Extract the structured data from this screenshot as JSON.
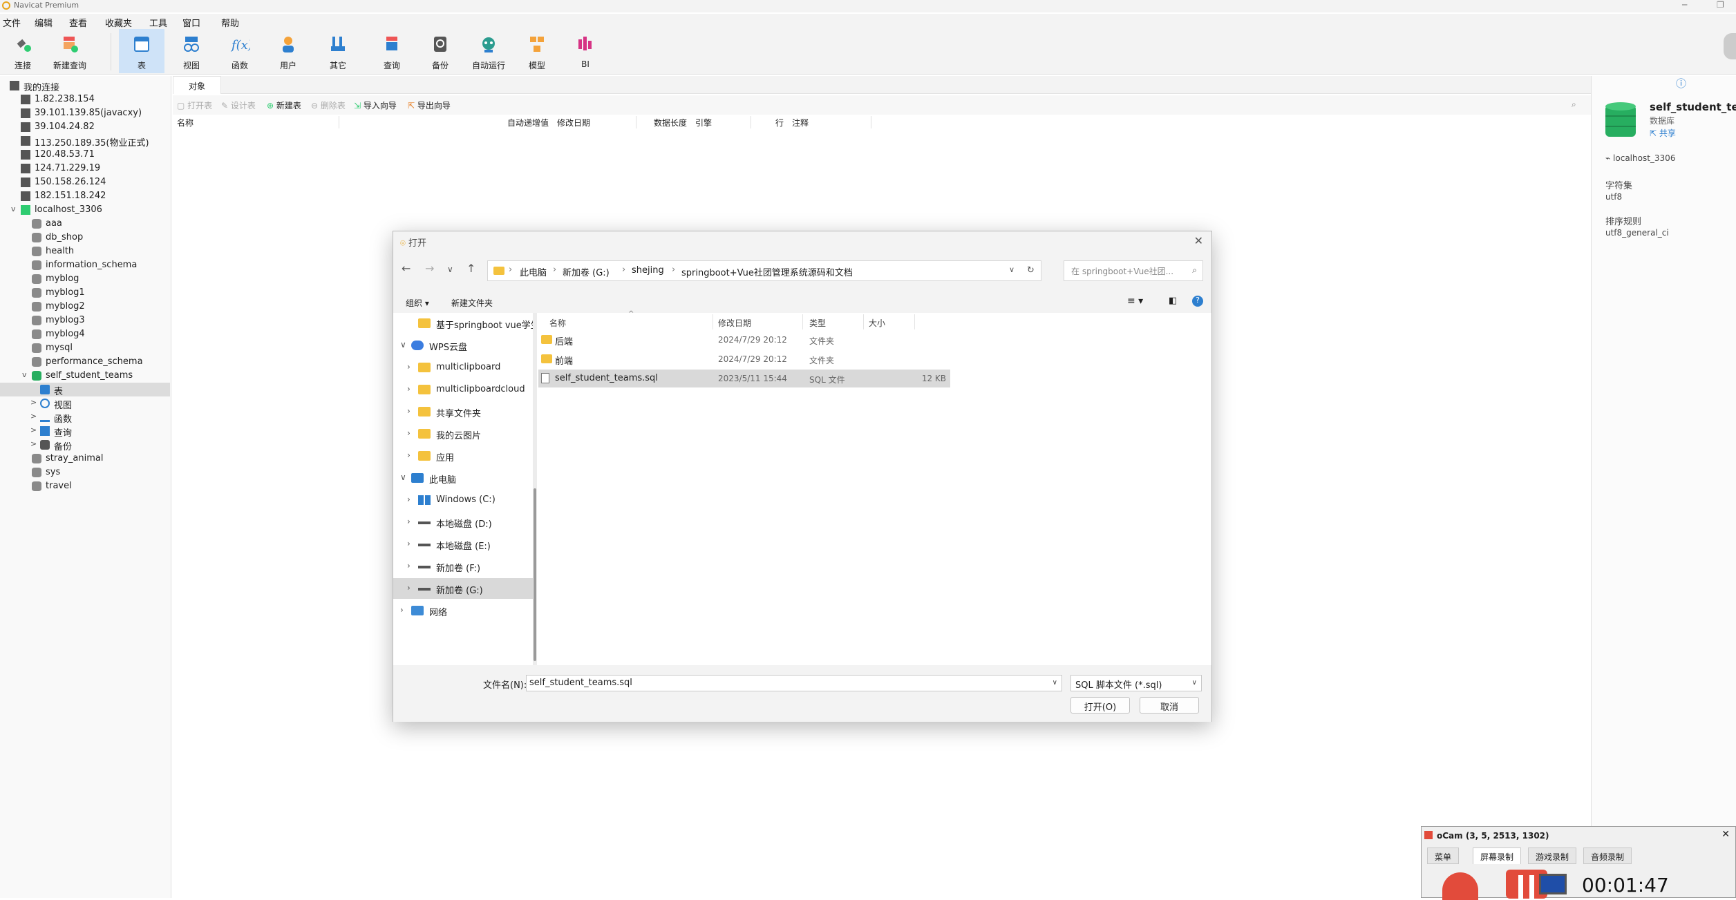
{
  "window": {
    "title": "Navicat Premium"
  },
  "menu": [
    "文件",
    "编辑",
    "查看",
    "收藏夹",
    "工具",
    "窗口",
    "帮助"
  ],
  "toolbar": {
    "items": [
      {
        "label": "连接",
        "icon": "plug-icon"
      },
      {
        "label": "新建查询",
        "icon": "new-query-icon"
      },
      {
        "label": "表",
        "icon": "table-icon"
      },
      {
        "label": "视图",
        "icon": "view-icon"
      },
      {
        "label": "函数",
        "icon": "function-icon"
      },
      {
        "label": "用户",
        "icon": "user-icon"
      },
      {
        "label": "其它",
        "icon": "other-tools-icon"
      },
      {
        "label": "查询",
        "icon": "query-icon"
      },
      {
        "label": "备份",
        "icon": "backup-icon"
      },
      {
        "label": "自动运行",
        "icon": "robot-icon"
      },
      {
        "label": "模型",
        "icon": "model-icon"
      },
      {
        "label": "BI",
        "icon": "bi-icon"
      }
    ]
  },
  "nav": {
    "root": "我的连接",
    "connections": [
      "1.82.238.154",
      "39.101.139.85(javacxy)",
      "39.104.24.82",
      "113.250.189.35(物业正式)",
      "120.48.53.71",
      "124.71.229.19",
      "150.158.26.124",
      "182.151.18.242"
    ],
    "local": "localhost_3306",
    "databases_before": [
      "aaa",
      "db_shop",
      "health",
      "information_schema",
      "myblog",
      "myblog1",
      "myblog2",
      "myblog3",
      "myblog4",
      "mysql",
      "performance_schema"
    ],
    "open_db": "self_student_teams",
    "open_db_children": [
      "表",
      "视图",
      "函数",
      "查询",
      "备份"
    ],
    "databases_after": [
      "stray_animal",
      "sys",
      "travel"
    ]
  },
  "main": {
    "tab": "对象",
    "objbar": [
      "打开表",
      "设计表",
      "新建表",
      "删除表",
      "导入向导",
      "导出向导"
    ],
    "columns": [
      "名称",
      "自动递增值",
      "修改日期",
      "数据长度",
      "引擎",
      "行",
      "注释"
    ]
  },
  "info": {
    "name": "self_student_teams",
    "type": "数据库",
    "share": "共享",
    "conn": "localhost_3306",
    "charset_label": "字符集",
    "charset": "utf8",
    "collation_label": "排序规则",
    "collation": "utf8_general_ci"
  },
  "dialog": {
    "title": "打开",
    "path": [
      "此电脑",
      "新加卷 (G:)",
      "shejing",
      "springboot+Vue社团管理系统源码和文档"
    ],
    "search_placeholder": "在 springboot+Vue社团...",
    "cmd_organize": "组织 ▾",
    "cmd_newfolder": "新建文件夹",
    "tree": [
      {
        "label": "基于springboot vue学生",
        "icon": "folder",
        "indent": 1,
        "chev": ""
      },
      {
        "label": "WPS云盘",
        "icon": "cloud",
        "indent": 0,
        "chev": "v"
      },
      {
        "label": "multiclipboard",
        "icon": "folder",
        "indent": 1,
        "chev": ">"
      },
      {
        "label": "multiclipboardcloud",
        "icon": "folder",
        "indent": 1,
        "chev": ">"
      },
      {
        "label": "共享文件夹",
        "icon": "folder",
        "indent": 1,
        "chev": ">"
      },
      {
        "label": "我的云图片",
        "icon": "folder",
        "indent": 1,
        "chev": ">"
      },
      {
        "label": "应用",
        "icon": "folder",
        "indent": 1,
        "chev": ">"
      },
      {
        "label": "此电脑",
        "icon": "pc",
        "indent": 0,
        "chev": "v"
      },
      {
        "label": "Windows (C:)",
        "icon": "win",
        "indent": 1,
        "chev": ">"
      },
      {
        "label": "本地磁盘 (D:)",
        "icon": "drive",
        "indent": 1,
        "chev": ">"
      },
      {
        "label": "本地磁盘 (E:)",
        "icon": "drive",
        "indent": 1,
        "chev": ">"
      },
      {
        "label": "新加卷 (F:)",
        "icon": "drive",
        "indent": 1,
        "chev": ">"
      },
      {
        "label": "新加卷 (G:)",
        "icon": "drive",
        "indent": 1,
        "chev": ">",
        "selected": true
      },
      {
        "label": "网络",
        "icon": "net",
        "indent": 0,
        "chev": ">"
      }
    ],
    "list_headers": [
      "名称",
      "修改日期",
      "类型",
      "大小"
    ],
    "files": [
      {
        "name": "后端",
        "date": "2024/7/29 20:12",
        "type": "文件夹",
        "size": "",
        "icon": "folder"
      },
      {
        "name": "前端",
        "date": "2024/7/29 20:12",
        "type": "文件夹",
        "size": "",
        "icon": "folder"
      },
      {
        "name": "self_student_teams.sql",
        "date": "2023/5/11 15:44",
        "type": "SQL 文件",
        "size": "12 KB",
        "icon": "file",
        "selected": true
      }
    ],
    "filename_label": "文件名(N):",
    "filename_value": "self_student_teams.sql",
    "filetype": "SQL 脚本文件 (*.sql)",
    "open_btn": "打开(O)",
    "cancel_btn": "取消"
  },
  "ocam": {
    "title": "oCam (3, 5, 2513, 1302)",
    "tabs": [
      "菜单",
      "屏幕录制",
      "游戏录制",
      "音频录制"
    ],
    "time": "00:01:47"
  }
}
